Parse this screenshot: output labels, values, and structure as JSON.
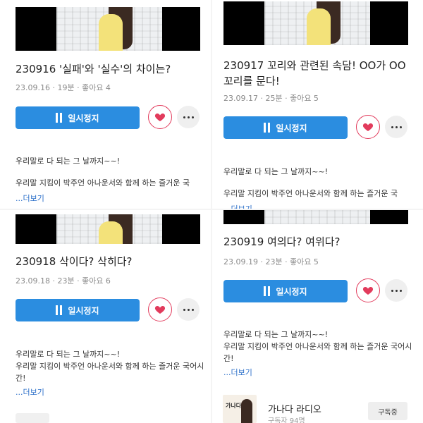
{
  "common": {
    "pause_label": "일시정지",
    "more_link": "...더보기",
    "desc_line1": "우리말로 다 되는 그 날까지~~!",
    "desc_line2": "우리말 지킴이 박주언 아나운서와 함께 하는 즐거운 국어시간!",
    "desc_line2_truncated": "우리말 지킴이 박주언 아나운서와 함께 하는 즐거운 국"
  },
  "episodes": [
    {
      "title": "230916 '실패'와 '실수'의 차이는?",
      "meta": "23.09.16 · 19분 · 좋아요 4"
    },
    {
      "title": "230917 꼬리와 관련된 속담! OO가 OO꼬리를 문다!",
      "meta": "23.09.17 · 25분 · 좋아요 5"
    },
    {
      "title": "230918 삭이다? 삭히다?",
      "meta": "23.09.18 · 23분 · 좋아요 6"
    },
    {
      "title": "230919 여의다? 여위다?",
      "meta": "23.09.19 · 23분 · 좋아요 5"
    }
  ],
  "channel": {
    "avatar_text": "가나다",
    "name": "가나다 라디오",
    "meta": "구독자 94명",
    "subscribe_label": "구독중"
  },
  "colors": {
    "accent": "#2b8de0",
    "heart": "#e23b5c",
    "link": "#2b6fc9"
  },
  "icons": [
    "pause-icon",
    "heart-icon",
    "more-dots-icon"
  ]
}
